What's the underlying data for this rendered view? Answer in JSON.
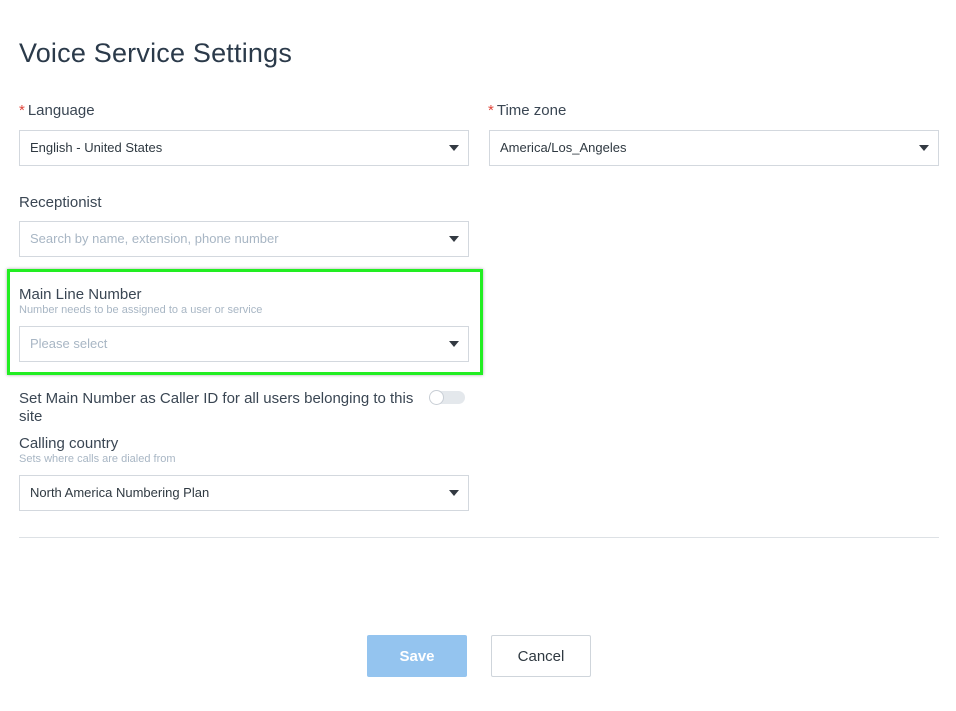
{
  "page": {
    "title": "Voice Service Settings"
  },
  "fields": {
    "language": {
      "required_mark": "*",
      "label": "Language",
      "value": "English - United States"
    },
    "timezone": {
      "required_mark": "*",
      "label": "Time zone",
      "value": "America/Los_Angeles"
    },
    "receptionist": {
      "label": "Receptionist",
      "placeholder": "Search by name, extension, phone number"
    },
    "main_line": {
      "label": "Main Line Number",
      "hint": "Number needs to be assigned to a user or service",
      "placeholder": "Please select"
    },
    "caller_id": {
      "label": "Set Main Number as Caller ID for all users belonging to this site",
      "enabled": false
    },
    "calling_country": {
      "label": "Calling country",
      "hint": "Sets where calls are dialed from",
      "value": "North America Numbering Plan"
    }
  },
  "buttons": {
    "save": "Save",
    "cancel": "Cancel"
  },
  "colors": {
    "highlight": "#22ee22",
    "save_bg": "#94c4ef",
    "required": "#e0453a"
  },
  "icons": {
    "dropdown": "caret-down-icon"
  }
}
